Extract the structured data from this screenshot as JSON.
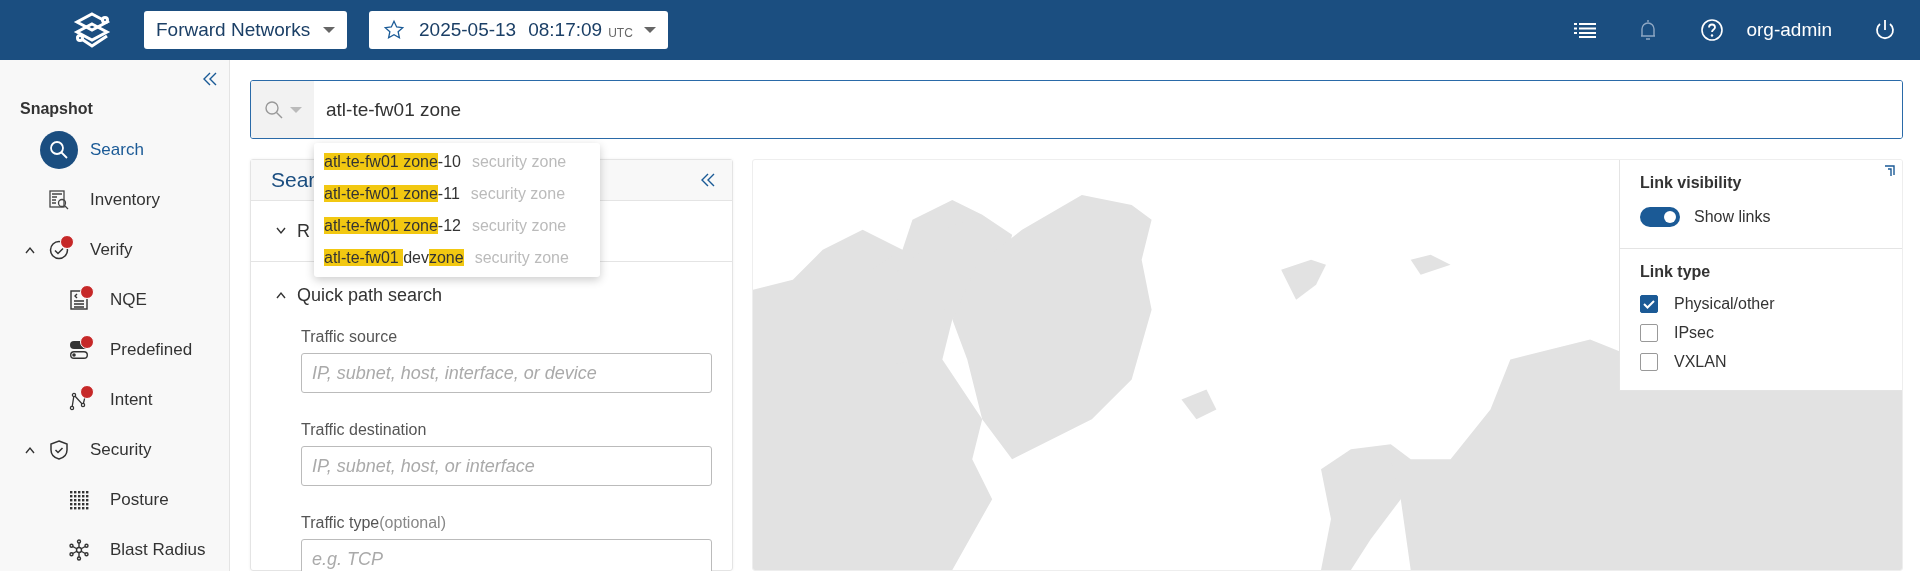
{
  "top_bar": {
    "network": "Forward Networks",
    "snapshot": {
      "date": "2025-05-13",
      "time": "08:17:09",
      "zone": "UTC",
      "favorite": false
    },
    "user": "org-admin"
  },
  "sidebar": {
    "heading": "Snapshot",
    "items": [
      {
        "label": "Search",
        "selected": true,
        "alert": false
      },
      {
        "label": "Inventory",
        "selected": false,
        "alert": false
      },
      {
        "label": "Verify",
        "selected": false,
        "alert": true,
        "expanded": true,
        "children": [
          {
            "label": "NQE",
            "selected": false,
            "alert": true
          },
          {
            "label": "Predefined",
            "selected": false,
            "alert": true
          },
          {
            "label": "Intent",
            "selected": false,
            "alert": true
          }
        ]
      },
      {
        "label": "Security",
        "selected": false,
        "alert": false,
        "expanded": true,
        "children": [
          {
            "label": "Posture",
            "selected": false,
            "alert": false
          },
          {
            "label": "Blast Radius",
            "selected": false,
            "alert": false
          }
        ]
      }
    ]
  },
  "search": {
    "query": "atl-te-fw01 zone",
    "suggestions": [
      {
        "parts": [
          {
            "text": "atl-te-fw01 zone",
            "match": true
          },
          {
            "text": "-10",
            "match": false
          }
        ],
        "type": "security zone"
      },
      {
        "parts": [
          {
            "text": "atl-te-fw01 zone",
            "match": true
          },
          {
            "text": "-11",
            "match": false
          }
        ],
        "type": "security zone"
      },
      {
        "parts": [
          {
            "text": "atl-te-fw01 zone",
            "match": true
          },
          {
            "text": "-12",
            "match": false
          }
        ],
        "type": "security zone"
      },
      {
        "parts": [
          {
            "text": "atl-te-fw01 ",
            "match": true
          },
          {
            "text": "dev",
            "match": false
          },
          {
            "text": "zone",
            "match": true
          }
        ],
        "type": "security zone"
      }
    ]
  },
  "search_panel": {
    "title": "Sear",
    "sections": [
      {
        "title": "R",
        "expanded": false
      },
      {
        "title": "Quick path search",
        "expanded": true
      }
    ],
    "fields": [
      {
        "label": "Traffic source",
        "placeholder": "IP, subnet, host, interface, or device"
      },
      {
        "label": "Traffic destination",
        "placeholder": "IP, subnet, host, or interface"
      },
      {
        "label": "Traffic type",
        "hint": "(optional)",
        "placeholder": "e.g. TCP"
      }
    ]
  },
  "map_panel": {
    "link_visibility": {
      "title": "Link visibility",
      "show_links": {
        "label": "Show links",
        "on": true
      }
    },
    "link_type": {
      "title": "Link type",
      "options": [
        {
          "label": "Physical/other",
          "checked": true
        },
        {
          "label": "IPsec",
          "checked": false
        },
        {
          "label": "VXLAN",
          "checked": false
        }
      ]
    }
  }
}
